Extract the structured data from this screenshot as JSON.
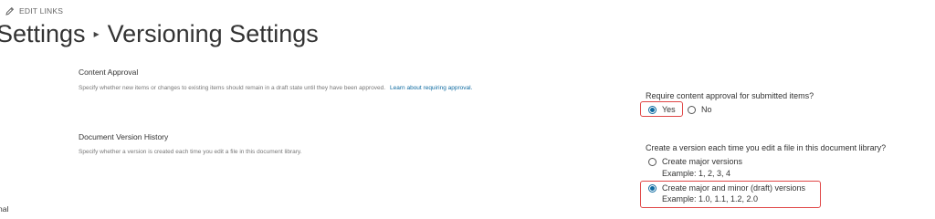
{
  "header": {
    "edit_links_label": "EDIT LINKS",
    "breadcrumb_parent": "Settings",
    "breadcrumb_separator": "▸",
    "page_title": "Versioning Settings"
  },
  "content_approval": {
    "title": "Content Approval",
    "description": "Specify whether new items or changes to existing items should remain in a draft state until they have been approved.",
    "learn_link": "Learn about requiring approval.",
    "question": "Require content approval for submitted items?",
    "options": [
      {
        "label": "Yes",
        "checked": true
      },
      {
        "label": "No",
        "checked": false
      }
    ]
  },
  "version_history": {
    "title": "Document Version History",
    "description": "Specify whether a version is created each time you edit a file in this document library.",
    "question": "Create a version each time you edit a file in this document library?",
    "options": [
      {
        "label": "Create major versions",
        "example": "Example: 1, 2, 3, 4",
        "checked": false
      },
      {
        "label": "Create major and minor (draft) versions",
        "example": "Example: 1.0, 1.1, 1.2, 2.0",
        "checked": true
      }
    ]
  },
  "partial_left_text": "nal",
  "colors": {
    "accent": "#0f6ba1",
    "highlight_border": "#e04646",
    "text": "#333333",
    "muted": "#777777"
  }
}
